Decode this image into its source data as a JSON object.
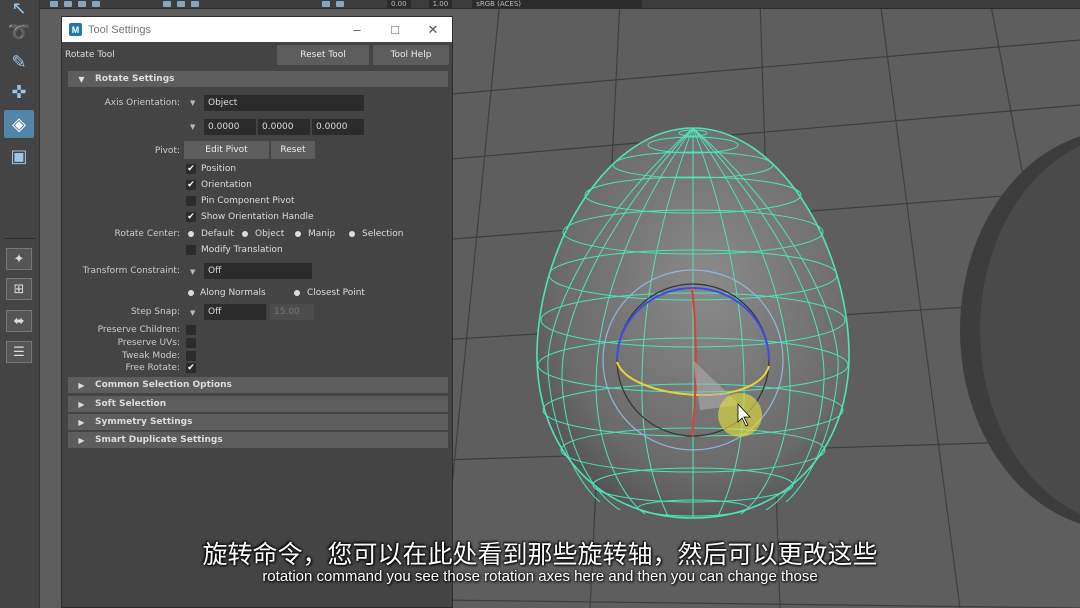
{
  "top_toolbar": {
    "field_a": "0.00",
    "field_b": "1.00",
    "colorspace": "sRGB (ACES)"
  },
  "toolbox": {
    "tools": [
      "select-tool-icon",
      "lasso-tool-icon",
      "paint-select-icon",
      "move-tool-icon",
      "rotate-tool-icon",
      "scale-tool-icon"
    ],
    "active": "rotate-tool-icon"
  },
  "tool_settings": {
    "window_title": "Tool Settings",
    "window_icon_letter": "M",
    "tool_name": "Rotate Tool",
    "reset_tool_label": "Reset Tool",
    "tool_help_label": "Tool Help",
    "rotate_settings": {
      "header": "Rotate Settings",
      "axis_orientation_label": "Axis Orientation:",
      "axis_orientation_value": "Object",
      "axis_values": [
        "0.0000",
        "0.0000",
        "0.0000"
      ],
      "pivot_label": "Pivot:",
      "edit_pivot_label": "Edit Pivot",
      "reset_label": "Reset",
      "position_label": "Position",
      "position_checked": true,
      "orientation_label": "Orientation",
      "orientation_checked": true,
      "pin_component_pivot_label": "Pin Component Pivot",
      "pin_component_pivot_checked": false,
      "show_orientation_handle_label": "Show Orientation Handle",
      "show_orientation_handle_checked": true,
      "rotate_center_label": "Rotate Center:",
      "rotate_center_options": [
        "Default",
        "Object",
        "Manip",
        "Selection"
      ],
      "rotate_center_selected": "Default",
      "modify_translation_label": "Modify Translation",
      "modify_translation_checked": false,
      "transform_constraint_label": "Transform Constraint:",
      "transform_constraint_value": "Off",
      "constraint_options": [
        "Along Normals",
        "Closest Point"
      ],
      "step_snap_label": "Step Snap:",
      "step_snap_value": "Off",
      "step_snap_amount": "15.00",
      "preserve_children_label": "Preserve Children:",
      "preserve_uvs_label": "Preserve UVs:",
      "tweak_mode_label": "Tweak Mode:",
      "free_rotate_label": "Free Rotate:",
      "free_rotate_checked": true
    },
    "collapsed_sections": [
      "Common Selection Options",
      "Soft Selection",
      "Symmetry Settings",
      "Smart Duplicate Settings"
    ]
  },
  "subtitles": {
    "chinese": "旋转命令，您可以在此处看到那些旋转轴，然后可以更改这些",
    "english": "rotation command you see those rotation axes here and then you can change those"
  },
  "colors": {
    "wireframe": "#4fe3b8",
    "x_axis": "#e53a3a",
    "y_axis": "#e8d23a",
    "z_axis": "#3a4ee5",
    "accent_blue": "#5285a6"
  }
}
